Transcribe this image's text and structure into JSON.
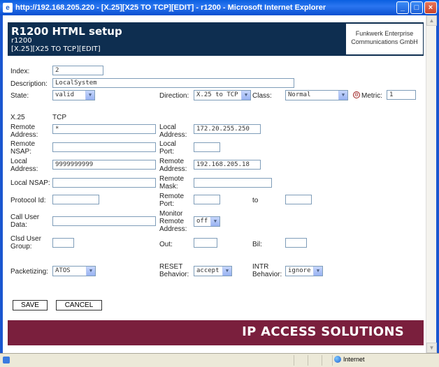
{
  "window": {
    "title": "http://192.168.205.220 - [X.25][X25 TO TCP][EDIT] - r1200 - Microsoft Internet Explorer",
    "min_glyph": "_",
    "max_glyph": "□",
    "close_glyph": "×"
  },
  "header": {
    "title": "R1200 HTML setup",
    "device": "r1200",
    "path": "[X.25][X25 TO TCP][EDIT]",
    "brand_line1": "Funkwerk Enterprise",
    "brand_line2": "Communications GmbH"
  },
  "form": {
    "index_label": "Index:",
    "index_value": "2",
    "description_label": "Description:",
    "description_value": "LocalSystem",
    "state_label": "State:",
    "state_value": "valid",
    "direction_label": "Direction:",
    "direction_value": "X.25 to TCP",
    "class_label": "Class:",
    "class_value": "Normal",
    "metric_label": "Metric:",
    "metric_value": "1",
    "col_x25": "X.25",
    "col_tcp": "TCP",
    "remote_address_label": "Remote Address:",
    "remote_address_value": "*",
    "local_address_tcp_label": "Local Address:",
    "local_address_tcp_value": "172.20.255.250",
    "remote_nsap_label": "Remote NSAP:",
    "remote_nsap_value": "",
    "local_port_label": "Local Port:",
    "local_port_value": "",
    "local_address_x25_label": "Local Address:",
    "local_address_x25_value": "9999999999",
    "remote_address_tcp_label": "Remote Address:",
    "remote_address_tcp_value": "192.168.205.18",
    "local_nsap_label": "Local NSAP:",
    "local_nsap_value": "",
    "remote_mask_label": "Remote Mask:",
    "remote_mask_value": "",
    "protocol_id_label": "Protocol Id:",
    "protocol_id_value": "",
    "remote_port_label": "Remote Port:",
    "remote_port_value": "",
    "to_label": "to",
    "to_value": "",
    "call_user_data_label": "Call User Data:",
    "call_user_data_value": "",
    "monitor_remote_label": "Monitor Remote Address:",
    "monitor_remote_value": "off",
    "clsd_user_group_label": "Clsd User Group:",
    "clsd_user_group_value": "",
    "out_label": "Out:",
    "out_value": "",
    "bil_label": "Bil:",
    "bil_value": "",
    "packetizing_label": "Packetizing:",
    "packetizing_value": "ATOS",
    "reset_behavior_label": "RESET Behavior:",
    "reset_behavior_value": "accept",
    "intr_behavior_label": "INTR Behavior:",
    "intr_behavior_value": "ignore"
  },
  "buttons": {
    "save": "SAVE",
    "cancel": "CANCEL"
  },
  "banner": {
    "text": "IP ACCESS SOLUTIONS"
  },
  "statusbar": {
    "zone": "Internet"
  },
  "colors": {
    "header_bg": "#0e2e50",
    "banner_bg": "#7a1f3d",
    "titlebar": "#0a5fe0"
  }
}
